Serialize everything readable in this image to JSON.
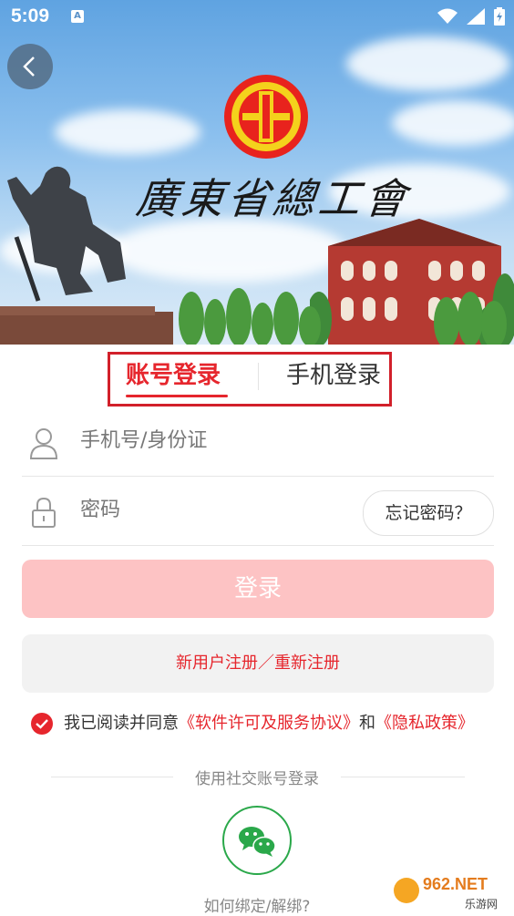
{
  "status_bar": {
    "time": "5:09",
    "indicator": "A",
    "icons": [
      "wifi-icon",
      "signal-icon",
      "battery-charging-icon"
    ]
  },
  "header": {
    "back_icon": "chevron-left-icon",
    "banner_title": "廣東省總工會"
  },
  "tabs": [
    {
      "label": "账号登录",
      "active": true
    },
    {
      "label": "手机登录",
      "active": false
    }
  ],
  "form": {
    "account_placeholder": "手机号/身份证",
    "password_placeholder": "密码",
    "forgot_label": "忘记密码？"
  },
  "login_label": "登录",
  "register_label": "新用户注册／重新注册",
  "agreement": {
    "prefix": "我已阅读并同意",
    "license_link": "《软件许可及服务协议》",
    "connector": "和",
    "privacy_link": "《隐私政策》",
    "checked": true
  },
  "social": {
    "label": "使用社交账号登录",
    "wechat_icon": "wechat-icon",
    "bind_help": "如何绑定/解绑?"
  },
  "watermark": {
    "text": "962.NET",
    "subtext": "乐游网"
  },
  "colors": {
    "accent": "#e6262d",
    "login_disabled": "#fdc3c4",
    "wechat": "#2aa84a"
  }
}
